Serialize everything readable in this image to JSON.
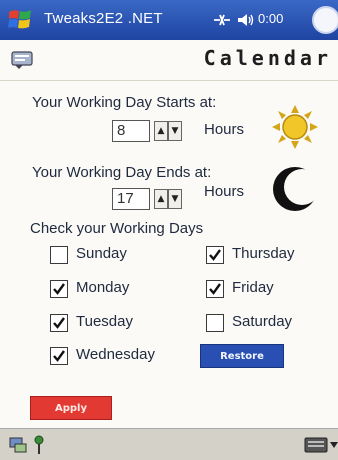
{
  "title_bar": {
    "app_name": "Tweaks2E2 .NET",
    "clock": "0:00",
    "ok_label": ""
  },
  "header": {
    "title": "Calendar"
  },
  "work_hours": {
    "start_label": "Your Working Day Starts at:",
    "start_value": "8",
    "start_unit": "Hours",
    "end_label": "Your Working Day Ends at:",
    "end_value": "17",
    "end_unit": "Hours"
  },
  "working_days": {
    "heading": "Check your Working Days",
    "days": [
      {
        "label": "Sunday",
        "checked": false
      },
      {
        "label": "Monday",
        "checked": true
      },
      {
        "label": "Tuesday",
        "checked": true
      },
      {
        "label": "Wednesday",
        "checked": true
      },
      {
        "label": "Thursday",
        "checked": true
      },
      {
        "label": "Friday",
        "checked": true
      },
      {
        "label": "Saturday",
        "checked": false
      }
    ]
  },
  "buttons": {
    "restore": "Restore",
    "apply": "Apply"
  },
  "colors": {
    "title_bar": "#2a52b4",
    "restore_button": "#2a4fb2",
    "apply_button": "#e23a33",
    "sun": "#e1b11c",
    "moon": "#111111"
  },
  "icons": {
    "start": "windows-flag-icon",
    "connectivity": "connectivity-icon",
    "volume": "volume-icon",
    "menu": "menu-icon",
    "sun": "sun-icon",
    "moon": "moon-icon",
    "keyboard": "keyboard-icon"
  }
}
